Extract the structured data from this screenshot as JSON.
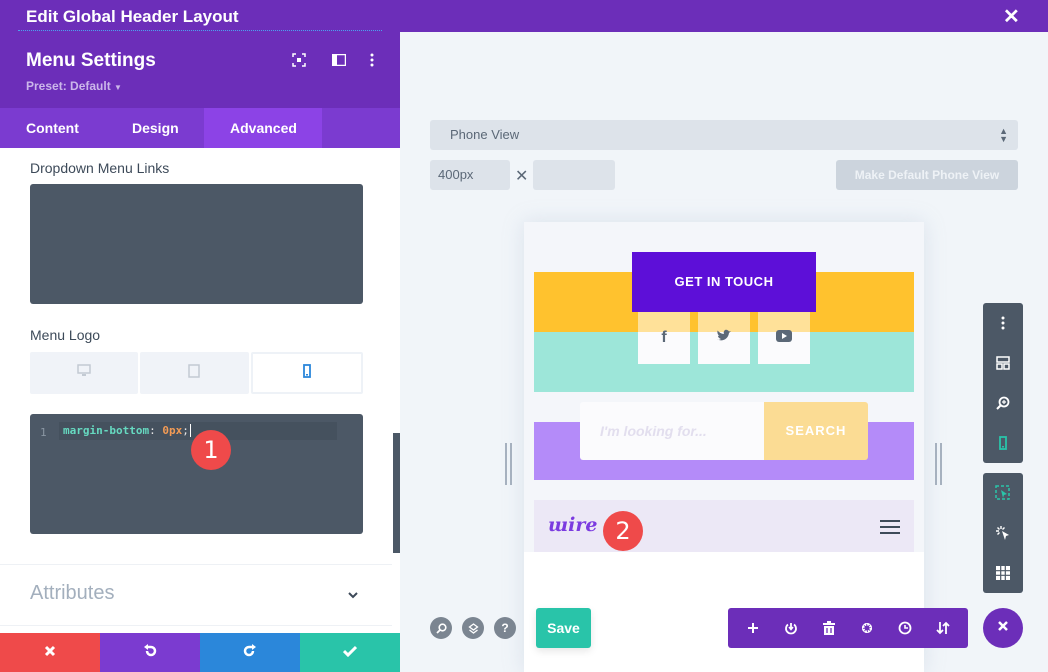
{
  "window": {
    "title": "Edit Global Header Layout",
    "close_icon": "close-icon"
  },
  "panel": {
    "title": "Menu Settings",
    "preset": "Preset: Default",
    "header_icons": [
      "fullscreen-icon",
      "split-view-icon",
      "more-vertical-icon"
    ],
    "tabs": [
      {
        "label": "Content",
        "active": false
      },
      {
        "label": "Design",
        "active": false
      },
      {
        "label": "Advanced",
        "active": true
      }
    ],
    "sections": {
      "dropdown_links": {
        "label": "Dropdown Menu Links"
      },
      "menu_logo": {
        "label": "Menu Logo",
        "devices": [
          {
            "name": "desktop",
            "active": false
          },
          {
            "name": "tablet",
            "active": false
          },
          {
            "name": "phone",
            "active": true
          }
        ],
        "code": {
          "line_number": "1",
          "property": "margin-bottom",
          "colon": ":",
          "value": "0px",
          "terminator": ";"
        }
      },
      "attributes": {
        "label": "Attributes"
      }
    },
    "actions": [
      {
        "name": "cancel",
        "color": "#ef4a4a"
      },
      {
        "name": "undo",
        "color": "#7b3bd0"
      },
      {
        "name": "redo",
        "color": "#2b87da"
      },
      {
        "name": "confirm",
        "color": "#29c4a9"
      }
    ]
  },
  "annotations": {
    "badge1": "1",
    "badge2": "2"
  },
  "canvas": {
    "view_select": "Phone View",
    "width_value": "400px",
    "height_value": "",
    "times": "✕",
    "make_default": "Make Default Phone View",
    "preview": {
      "cta": "GET IN TOUCH",
      "social": [
        "facebook",
        "twitter",
        "youtube"
      ],
      "search_placeholder": "I'm looking for...",
      "search_button": "SEARCH",
      "logo": "ɯire",
      "colors": {
        "cta": "#5d0fd8",
        "yellow_band": "#ffc22e",
        "teal_band": "#9de6d9",
        "purple_band": "#b48bf9",
        "search_button": "#fbdc94"
      }
    }
  },
  "right_toolbar": {
    "group1": [
      "more-vertical-icon",
      "layout-icon",
      "zoom-icon",
      "phone-icon"
    ],
    "group2": [
      "select-icon",
      "click-icon",
      "grid-icon"
    ]
  },
  "bottom_bar": {
    "left_icons": [
      "search-icon",
      "layers-icon",
      "help-icon"
    ],
    "help_label": "?",
    "save": "Save",
    "toolbar": [
      "add-icon",
      "power-icon",
      "trash-icon",
      "gear-icon",
      "history-icon",
      "sort-icon"
    ]
  }
}
